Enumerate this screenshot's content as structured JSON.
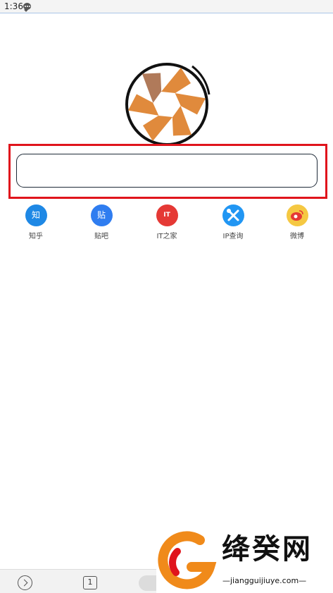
{
  "status_bar": {
    "time": "1:36"
  },
  "search": {
    "value": "",
    "placeholder": ""
  },
  "quick_links": [
    {
      "label": "知乎",
      "icon": "zhihu-icon",
      "icon_text": "知",
      "color": "#1e88e5"
    },
    {
      "label": "贴吧",
      "icon": "tieba-icon",
      "icon_text": "贴",
      "color": "#2f7df0"
    },
    {
      "label": "IT之家",
      "icon": "ithome-icon",
      "icon_text": "IT",
      "color": "#e53935"
    },
    {
      "label": "IP查询",
      "icon": "ip-lookup-icon",
      "color": "#2196f3"
    },
    {
      "label": "微博",
      "icon": "weibo-icon",
      "color": "#f5c842"
    }
  ],
  "bottom_bar": {
    "tab_count": "1"
  },
  "watermark": {
    "brand": "绛癸网",
    "url": "—jiangguijiuye.com—"
  },
  "colors": {
    "highlight": "#e0141c",
    "logo_orange": "#e08a3c",
    "logo_ring": "#111111"
  }
}
